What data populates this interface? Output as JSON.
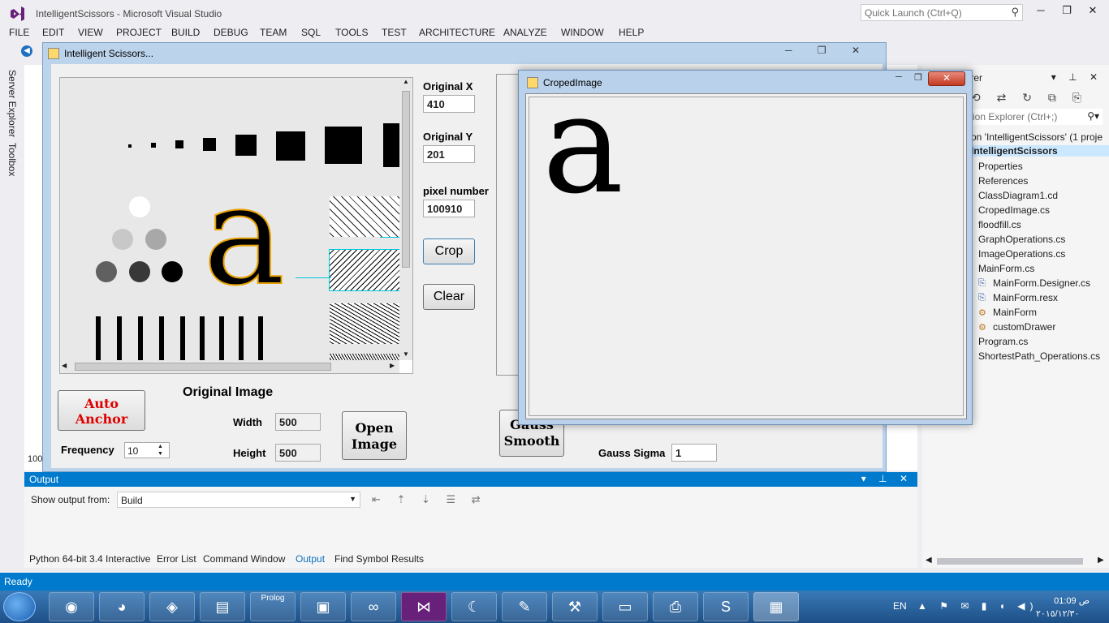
{
  "vs": {
    "title": "IntelligentScissors - Microsoft Visual Studio",
    "quick_launch_placeholder": "Quick Launch (Ctrl+Q)",
    "menu": [
      "FILE",
      "EDIT",
      "VIEW",
      "PROJECT",
      "BUILD",
      "DEBUG",
      "TEAM",
      "SQL",
      "TOOLS",
      "TEST",
      "ARCHITECTURE",
      "ANALYZE",
      "WINDOW",
      "HELP"
    ],
    "side_tabs": [
      "Server Explorer",
      "Toolbox"
    ],
    "status": "Ready"
  },
  "output_panel": {
    "title": "Output",
    "show_from_label": "Show output from:",
    "show_from_value": "Build",
    "tabs": [
      "Python 64-bit 3.4 Interactive",
      "Error List",
      "Command Window",
      "Output",
      "Find Symbol Results"
    ],
    "active_tab": "Output"
  },
  "solution_explorer": {
    "header": "lorer",
    "search_placeholder": "ution Explorer (Ctrl+;)",
    "solution_line": "on 'IntelligentScissors' (1 proje",
    "project": "IntelligentScissors",
    "items": [
      "Properties",
      "References",
      "ClassDiagram1.cd",
      "CropedImage.cs",
      "floodfill.cs",
      "GraphOperations.cs",
      "ImageOperations.cs",
      "MainForm.cs"
    ],
    "children": [
      "MainForm.Designer.cs",
      "MainForm.resx",
      "MainForm",
      "customDrawer"
    ],
    "items_after": [
      "Program.cs",
      "ShortestPath_Operations.cs"
    ]
  },
  "main_form": {
    "title": "Intelligent Scissors...",
    "original_x_label": "Original X",
    "original_x_value": "410",
    "original_y_label": "Original Y",
    "original_y_value": "201",
    "pixel_number_label": "pixel number",
    "pixel_number_value": "100910",
    "crop_button": "Crop",
    "clear_button": "Clear",
    "auto_anchor_button": "Auto Anchor",
    "original_image_label": "Original Image",
    "width_label": "Width",
    "width_value": "500",
    "height_label": "Height",
    "height_value": "500",
    "frequency_label": "Frequency",
    "frequency_value": "10",
    "open_image_button": "Open Image",
    "gauss_smooth_button": "Gauss Smooth",
    "gauss_sigma_label": "Gauss Sigma",
    "gauss_sigma_value": "1",
    "image_letter": "a",
    "left_edge_text": "100"
  },
  "crop_form": {
    "title": "CropedImage",
    "cropped_letter": "a"
  },
  "taskbar": {
    "lang": "EN",
    "time": "01:09 ص",
    "date": "٢٠١٥/١٢/٣٠",
    "prolog_label": "Prolog"
  },
  "colors": {
    "accent": "#007acc",
    "auto_anchor_text": "#e00000",
    "selection_outline": "#00c8d8"
  }
}
